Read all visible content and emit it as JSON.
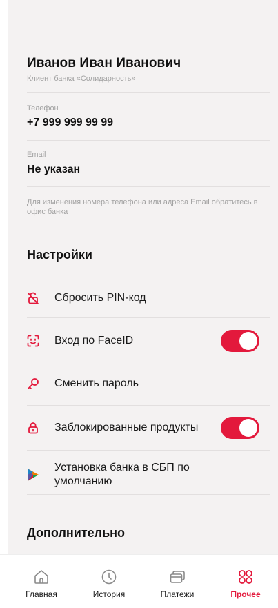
{
  "profile": {
    "name": "Иванов Иван Иванович",
    "subtitle": "Клиент банка  «Солидарность»"
  },
  "fields": {
    "phone_label": "Телефон",
    "phone_value": "+7 999 999 99 99",
    "email_label": "Email",
    "email_value": "Не указан"
  },
  "hint": "Для изменения номера телефона или адреса Email обратитесь в офис банка",
  "settings": {
    "title": "Настройки",
    "items": [
      {
        "label": "Сбросить PIN-код",
        "icon": "lock-slash-icon"
      },
      {
        "label": "Вход по FaceID",
        "icon": "face-id-icon",
        "toggle": true
      },
      {
        "label": "Сменить пароль",
        "icon": "key-icon"
      },
      {
        "label": "Заблокированные продукты",
        "icon": "lock-icon",
        "toggle": true
      },
      {
        "label": "Установка банка в СБП по умолчанию",
        "icon": "sbp-logo-icon"
      }
    ]
  },
  "additional": {
    "title": "Дополнительно"
  },
  "tabbar": {
    "items": [
      {
        "label": "Главная",
        "icon": "home-icon"
      },
      {
        "label": "История",
        "icon": "clock-icon"
      },
      {
        "label": "Платежи",
        "icon": "cards-icon"
      },
      {
        "label": "Прочее",
        "icon": "grid-icon",
        "active": true
      }
    ]
  },
  "colors": {
    "accent": "#e3193c",
    "panel_bg": "#f4f2f2",
    "muted_text": "#a2a2a2"
  }
}
